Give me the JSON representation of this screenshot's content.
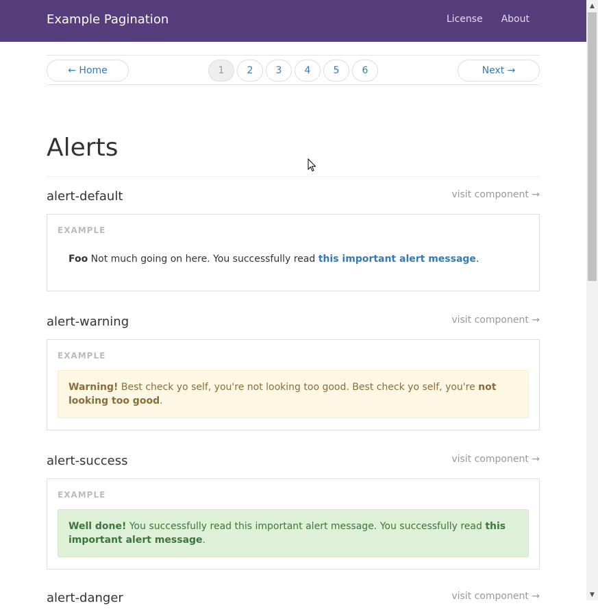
{
  "navbar": {
    "brand": "Example Pagination",
    "links": [
      "License",
      "About"
    ]
  },
  "pager": {
    "prev": "← Home",
    "pages": [
      "1",
      "2",
      "3",
      "4",
      "5",
      "6"
    ],
    "active_page": "1",
    "next": "Next →"
  },
  "page_title": "Alerts",
  "sections": [
    {
      "name": "alert-default",
      "visit": "visit component →",
      "example_label": "EXAMPLE",
      "strong": "Foo",
      "text": " Not much going on here. You successfully read ",
      "link": "this important alert message",
      "after": "."
    },
    {
      "name": "alert-warning",
      "visit": "visit component →",
      "example_label": "EXAMPLE",
      "strong": "Warning!",
      "text": " Best check yo self, you're not looking too good. Best check yo self, you're ",
      "emph": "not looking too good",
      "after": "."
    },
    {
      "name": "alert-success",
      "visit": "visit component →",
      "example_label": "EXAMPLE",
      "strong": "Well done!",
      "text": " You successfully read this important alert message. You successfully read ",
      "emph": "this important alert message",
      "after": "."
    },
    {
      "name": "alert-danger",
      "visit": "visit component →"
    }
  ],
  "colors": {
    "navbar_bg": "#563d7c",
    "link": "#337ab7",
    "warning_bg": "#fcf8e3",
    "success_bg": "#dff0d8"
  }
}
